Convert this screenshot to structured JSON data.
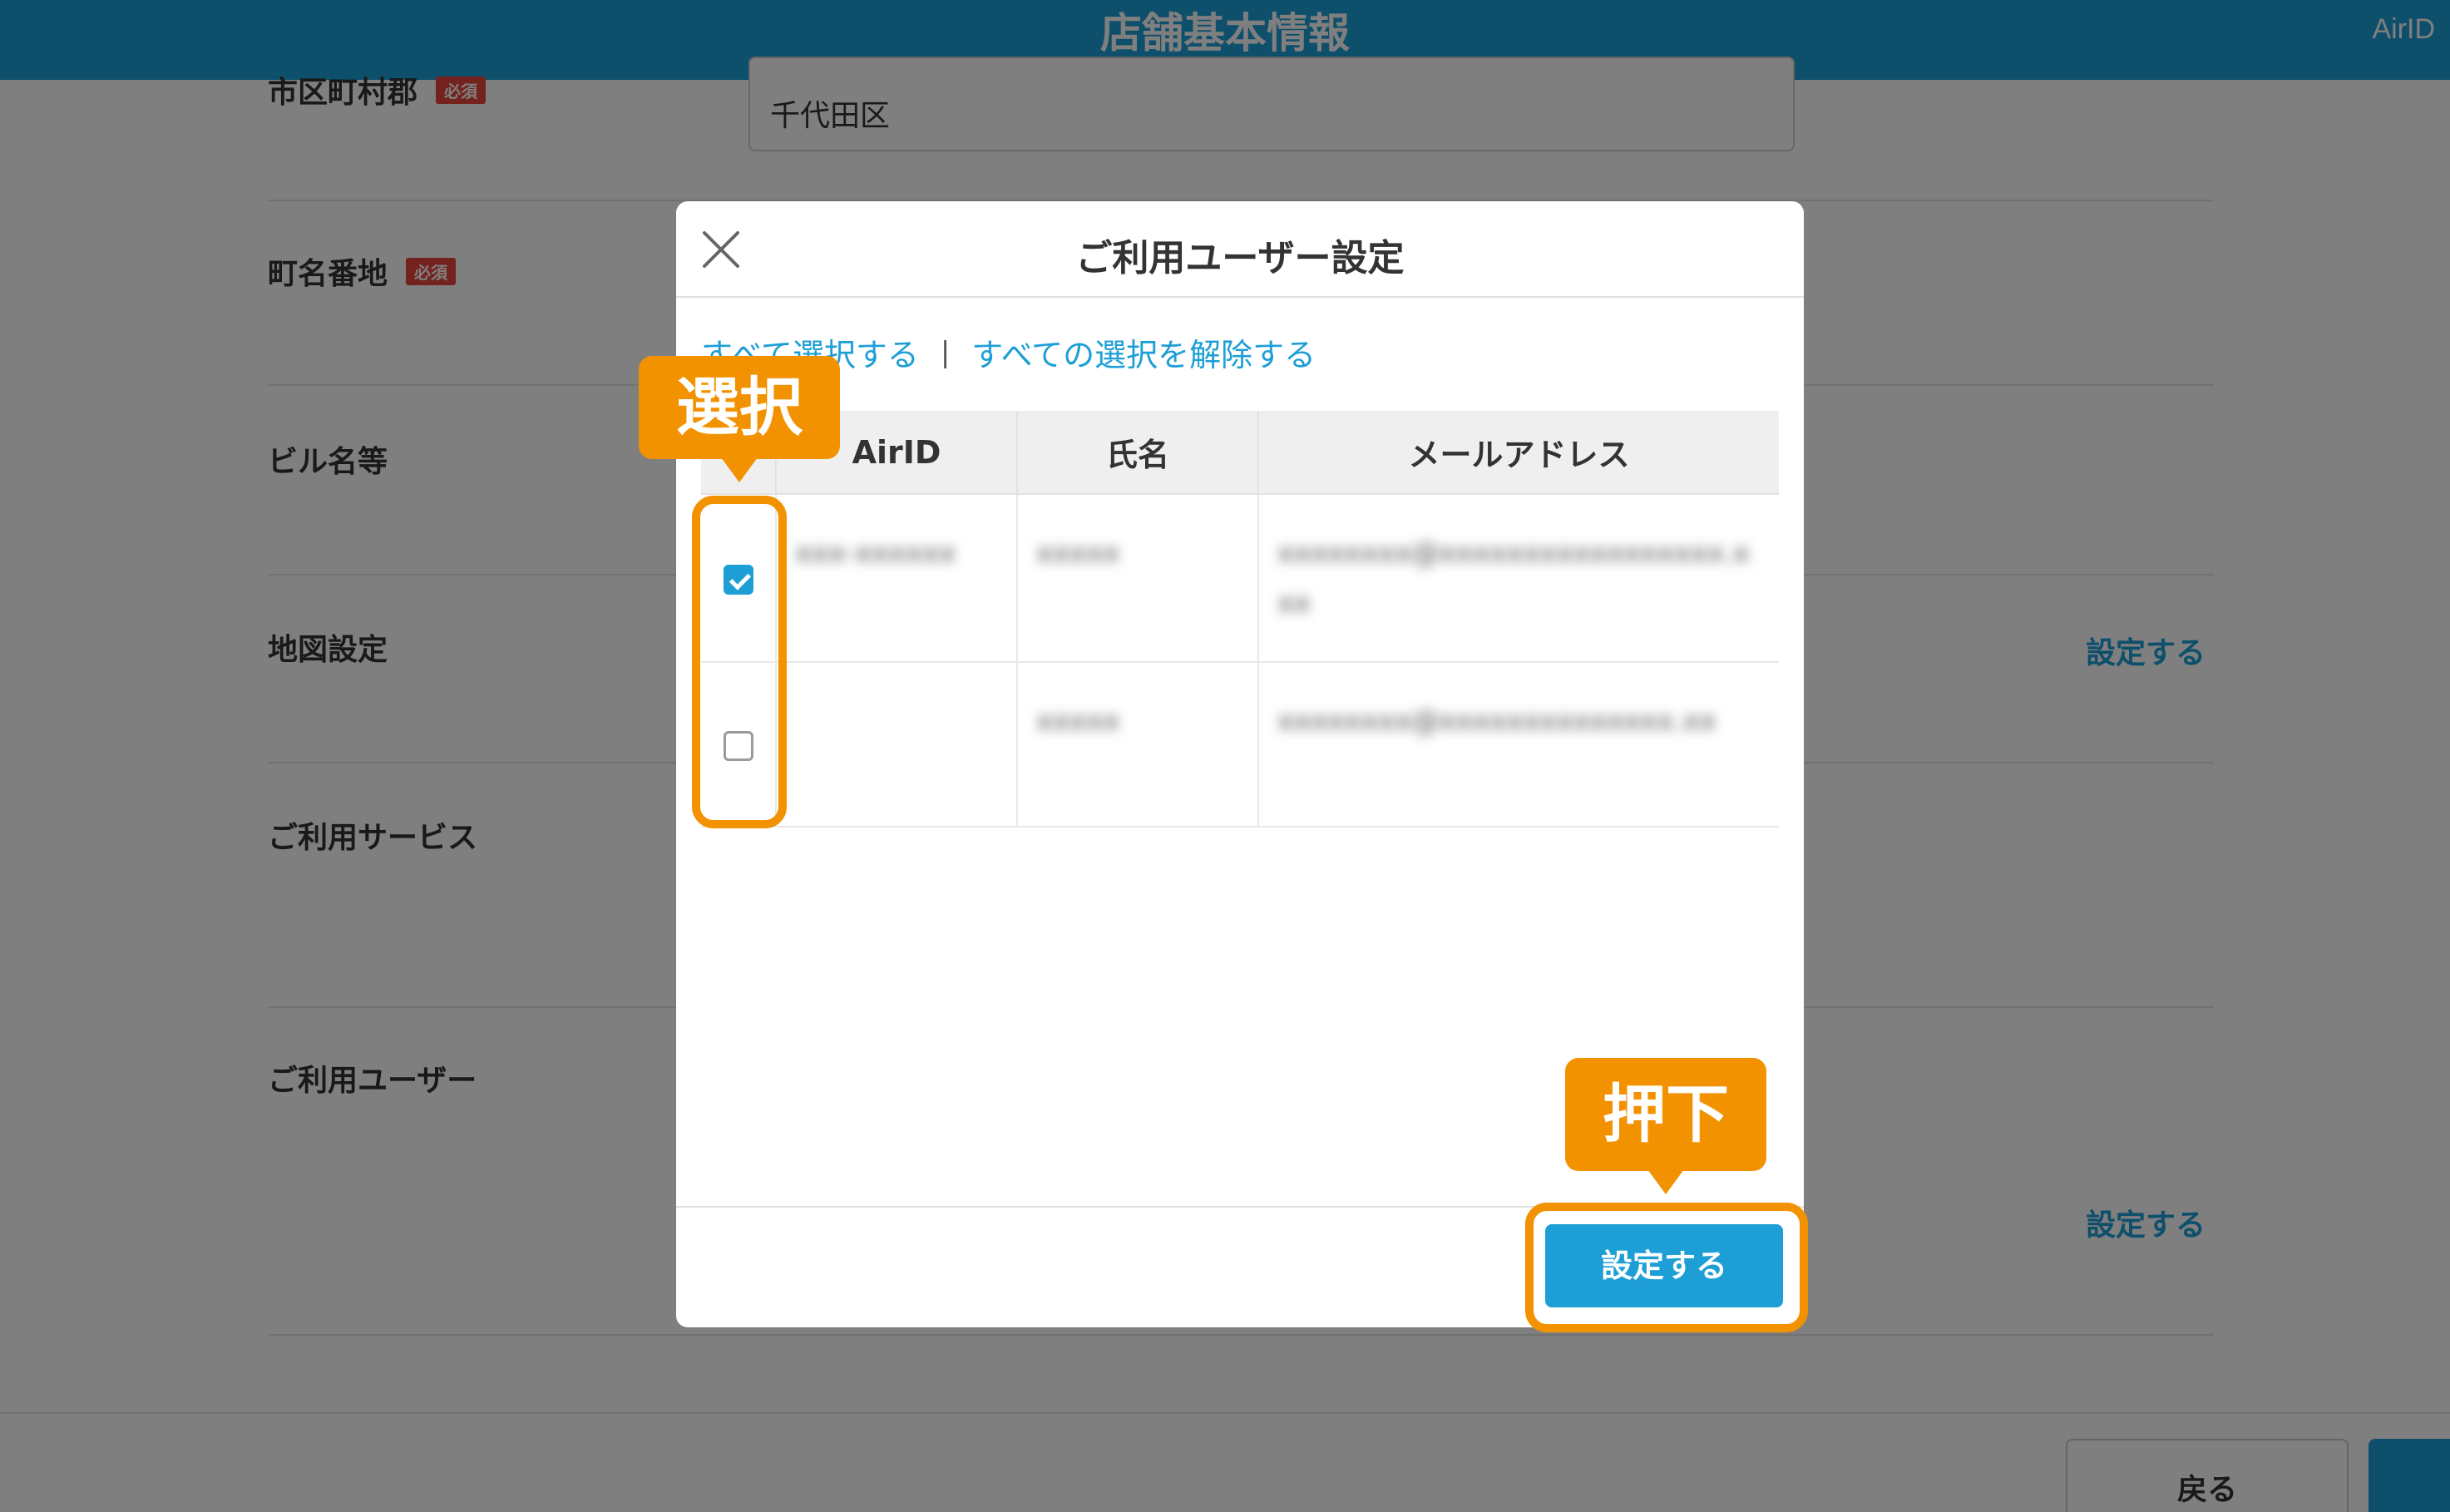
{
  "header": {
    "title": "店舗基本情報",
    "account": "AirID"
  },
  "form": {
    "city_label": "市区町村郡",
    "city_value": "千代田区",
    "street_label": "町名番地",
    "required_badge": "必須",
    "building_label": "ビル名等",
    "map_label": "地図設定",
    "services_label": "ご利用サービス",
    "users_label": "ご利用ユーザー",
    "set_link": "設定する"
  },
  "footer": {
    "back_label": "戻る"
  },
  "modal": {
    "title": "ご利用ユーザー設定",
    "select_all": "すべて選択する",
    "separator": "|",
    "deselect_all": "すべての選択を解除する",
    "columns": [
      "AirID",
      "氏名",
      "メールアドレス"
    ],
    "rows": [
      {
        "checked": true,
        "airid": "xxx-xxxxxx",
        "name": "xxxxx",
        "email": "xxxxxxxx@xxxxxxxxxxxxxxxxx.xxx"
      },
      {
        "checked": false,
        "airid": "",
        "name": "xxxxx",
        "email": "xxxxxxxx@xxxxxxxxxxxxxx.xx"
      }
    ],
    "submit_label": "設定する"
  },
  "annotations": {
    "select_callout": "選択",
    "press_callout": "押下"
  },
  "colors": {
    "brand_blue": "#1d9fd6",
    "callout_orange": "#f39200",
    "required_red": "#e8443a"
  }
}
